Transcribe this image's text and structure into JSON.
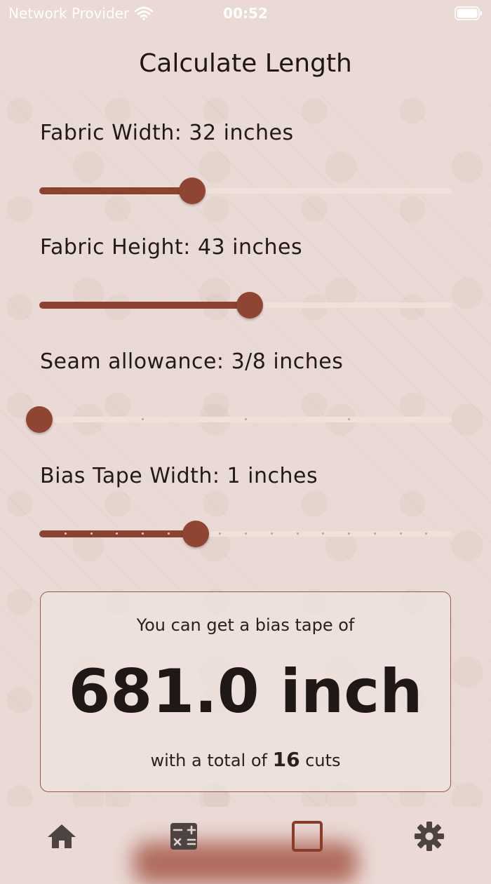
{
  "status": {
    "carrier": "Network Provider",
    "time": "00:52"
  },
  "title": "Calculate Length",
  "sliders": [
    {
      "label": "Fabric Width: 32 inches",
      "fraction": 0.37
    },
    {
      "label": "Fabric Height: 43 inches",
      "fraction": 0.51
    },
    {
      "label": "Seam allowance: 3/8 inches",
      "fraction": 0.0
    },
    {
      "label": "Bias Tape Width: 1 inches",
      "fraction": 0.38
    }
  ],
  "result": {
    "intro": "You can get a bias tape of",
    "value": "681.0 inch",
    "cuts_prefix": "with a total of",
    "cuts_count": "16",
    "cuts_suffix": "cuts"
  },
  "tabs": [
    {
      "icon": "home-icon"
    },
    {
      "icon": "calculator-icon"
    },
    {
      "icon": "square-icon"
    },
    {
      "icon": "gear-icon"
    }
  ],
  "colors": {
    "accent": "#8e4532",
    "background": "#ead9d4"
  }
}
